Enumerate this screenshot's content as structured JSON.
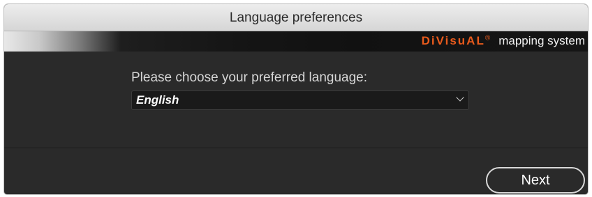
{
  "window": {
    "title": "Language preferences"
  },
  "banner": {
    "logo": "DiVisuAL",
    "logo_mark": "®",
    "tagline": "mapping system",
    "logo_color": "#e85a1c"
  },
  "main": {
    "prompt": "Please choose your preferred language:",
    "language_select": {
      "selected": "English"
    }
  },
  "footer": {
    "next_label": "Next"
  }
}
